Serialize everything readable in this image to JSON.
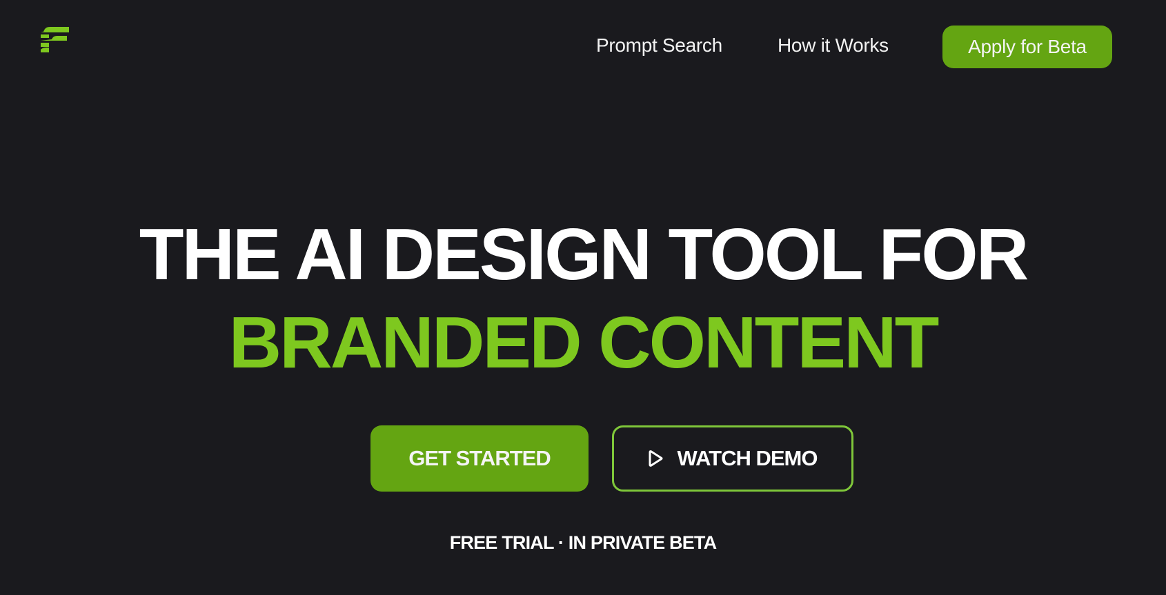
{
  "brand": {
    "logo_icon": "stacked-f-logo-icon",
    "accent_color": "#7ec81f",
    "button_color": "#64a512",
    "background_color": "#1a1a1e"
  },
  "nav": {
    "links": [
      {
        "label": "Prompt Search"
      },
      {
        "label": "How it Works"
      }
    ],
    "apply_label": "Apply for Beta"
  },
  "hero": {
    "headline_line1": "THE AI DESIGN TOOL FOR",
    "headline_line2": "BRANDED CONTENT",
    "primary_cta": "GET STARTED",
    "secondary_cta": "WATCH DEMO",
    "secondary_cta_icon": "play-icon",
    "tagline": "FREE TRIAL · IN PRIVATE BETA"
  }
}
